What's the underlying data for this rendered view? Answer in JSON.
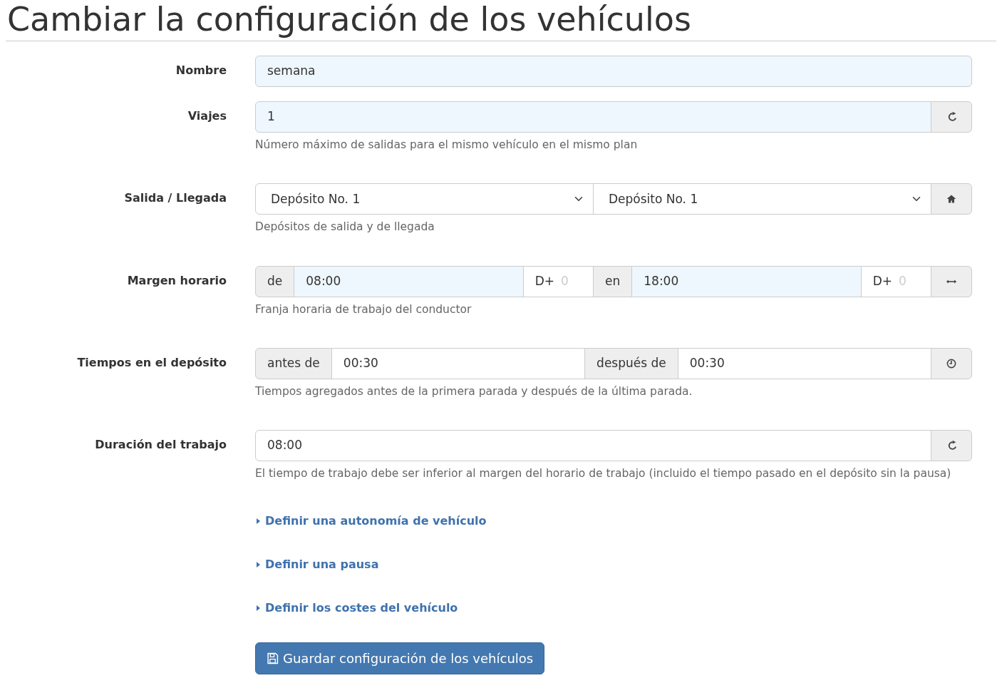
{
  "title": "Cambiar la configuración de los vehículos",
  "fields": [
    {
      "label": "Nombre",
      "parts": [
        {
          "kind": "input",
          "value": "semana",
          "highlighted": true
        }
      ]
    },
    {
      "label": "Viajes",
      "parts": [
        {
          "kind": "input",
          "value": "1",
          "highlighted": true
        }
      ],
      "button": {
        "kind": "reset"
      },
      "help": "Número máximo de salidas para el mismo vehículo en el mismo plan"
    },
    {
      "label": "Salida / Llegada",
      "parts": [
        {
          "kind": "select",
          "value": "Depósito No. 1"
        },
        {
          "kind": "select",
          "value": "Depósito No. 1"
        }
      ],
      "button": {
        "kind": "home"
      },
      "help": "Depósitos de salida y de llegada"
    },
    {
      "label": "Margen horario",
      "parts": [
        {
          "kind": "addon",
          "text": "de"
        },
        {
          "kind": "input",
          "value": "08:00",
          "highlighted": true
        },
        {
          "kind": "day",
          "text": "D+",
          "placeholder": "0"
        },
        {
          "kind": "addon",
          "text": "en"
        },
        {
          "kind": "input",
          "value": "18:00",
          "highlighted": true
        },
        {
          "kind": "day",
          "text": "D+",
          "placeholder": "0"
        }
      ],
      "button": {
        "kind": "swap"
      },
      "help": "Franja horaria de trabajo del conductor"
    },
    {
      "label": "Tiempos en el depósito",
      "parts": [
        {
          "kind": "addon",
          "text": "antes de"
        },
        {
          "kind": "input",
          "value": "00:30",
          "highlighted": false
        },
        {
          "kind": "addon",
          "text": "después de"
        },
        {
          "kind": "input",
          "value": "00:30",
          "highlighted": false
        }
      ],
      "button": {
        "kind": "clock"
      },
      "help": "Tiempos agregados antes de la primera parada y después de la última parada."
    },
    {
      "label": "Duración del trabajo",
      "parts": [
        {
          "kind": "input",
          "value": "08:00",
          "highlighted": false
        }
      ],
      "button": {
        "kind": "reset"
      },
      "help": "El tiempo de trabajo debe ser inferior al margen del horario de trabajo (incluido el tiempo pasado en el depósito sin la pausa)"
    }
  ],
  "links": [
    {
      "text": "Definir una autonomía de vehículo",
      "expanded": false
    },
    {
      "text": "Definir una pausa",
      "expanded": false
    },
    {
      "text": "Definir los costes del vehículo",
      "expanded": false
    }
  ],
  "save_button": "Guardar configuración de los vehículos"
}
